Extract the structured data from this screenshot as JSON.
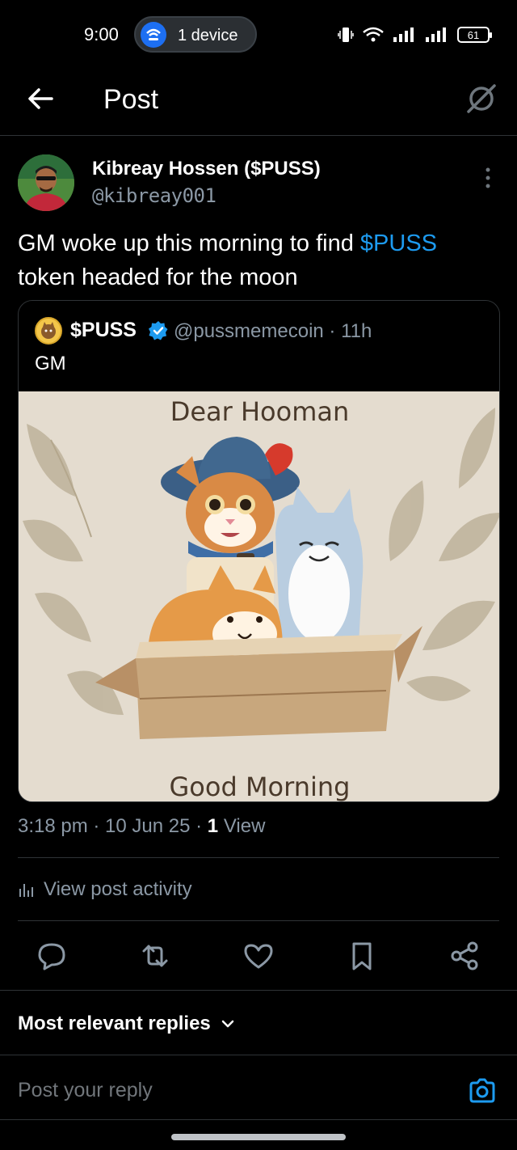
{
  "status_bar": {
    "time": "9:00",
    "hotspot_label": "1 device",
    "battery": "61",
    "icons": [
      "vibrate-icon",
      "wifi-icon",
      "signal-icon",
      "signal-icon",
      "battery-icon"
    ]
  },
  "header": {
    "title": "Post",
    "back_icon": "arrow-left-icon",
    "grok_icon": "grok-icon"
  },
  "post": {
    "author_name": "Kibreay Hossen ($PUSS)",
    "author_handle": "@kibreay001",
    "text_before": "GM woke up this morning to find ",
    "cashtag": "$PUSS",
    "text_after": "token headed for the moon",
    "time": "3:18 pm",
    "date": "10 Jun 25",
    "views_count": "1",
    "views_label": "View"
  },
  "quote": {
    "name": "$PUSS",
    "handle_time": "@pussmemecoin · 11h",
    "text": "GM",
    "image_top_text": "Dear Hooman",
    "image_bottom_text": "Good Morning"
  },
  "activity": {
    "label": "View post activity"
  },
  "actions": [
    "reply-icon",
    "repost-icon",
    "like-icon",
    "bookmark-icon",
    "share-icon"
  ],
  "replies": {
    "sort_label": "Most relevant replies"
  },
  "composer": {
    "placeholder": "Post your reply"
  },
  "colors": {
    "accent": "#1d9bf0",
    "background": "#000000",
    "muted": "#8b98a5",
    "divider": "#2f3336"
  }
}
